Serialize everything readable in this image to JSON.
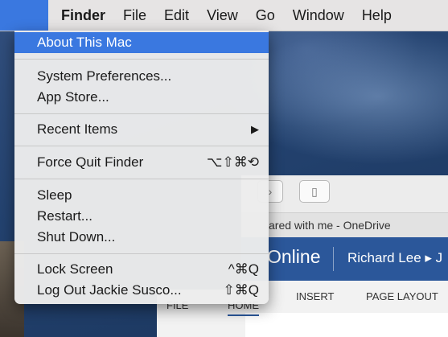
{
  "menubar": {
    "apple_icon": "",
    "items": [
      "Finder",
      "File",
      "Edit",
      "View",
      "Go",
      "Window",
      "Help"
    ]
  },
  "apple_menu": {
    "about": "About This Mac",
    "system_prefs": "System Preferences...",
    "app_store": "App Store...",
    "recent_items": "Recent Items",
    "recent_arrow": "▶",
    "force_quit": "Force Quit Finder",
    "force_quit_shortcut": "⌥⇧⌘⟲",
    "sleep": "Sleep",
    "restart": "Restart...",
    "shutdown": "Shut Down...",
    "lock_screen": "Lock Screen",
    "lock_shortcut": "^⌘Q",
    "logout": "Log Out Jackie Susco...",
    "logout_shortcut": "⇧⌘Q"
  },
  "background_window": {
    "tab_title": "ared with me - OneDrive",
    "brand": "Online",
    "breadcrumb": "Richard Lee ▸ J",
    "ribbon_tabs": [
      "FILE",
      "HOME",
      "INSERT",
      "PAGE LAYOUT"
    ]
  },
  "colors": {
    "menu_highlight": "#3a78e0",
    "brand_bar": "#2b579a"
  }
}
